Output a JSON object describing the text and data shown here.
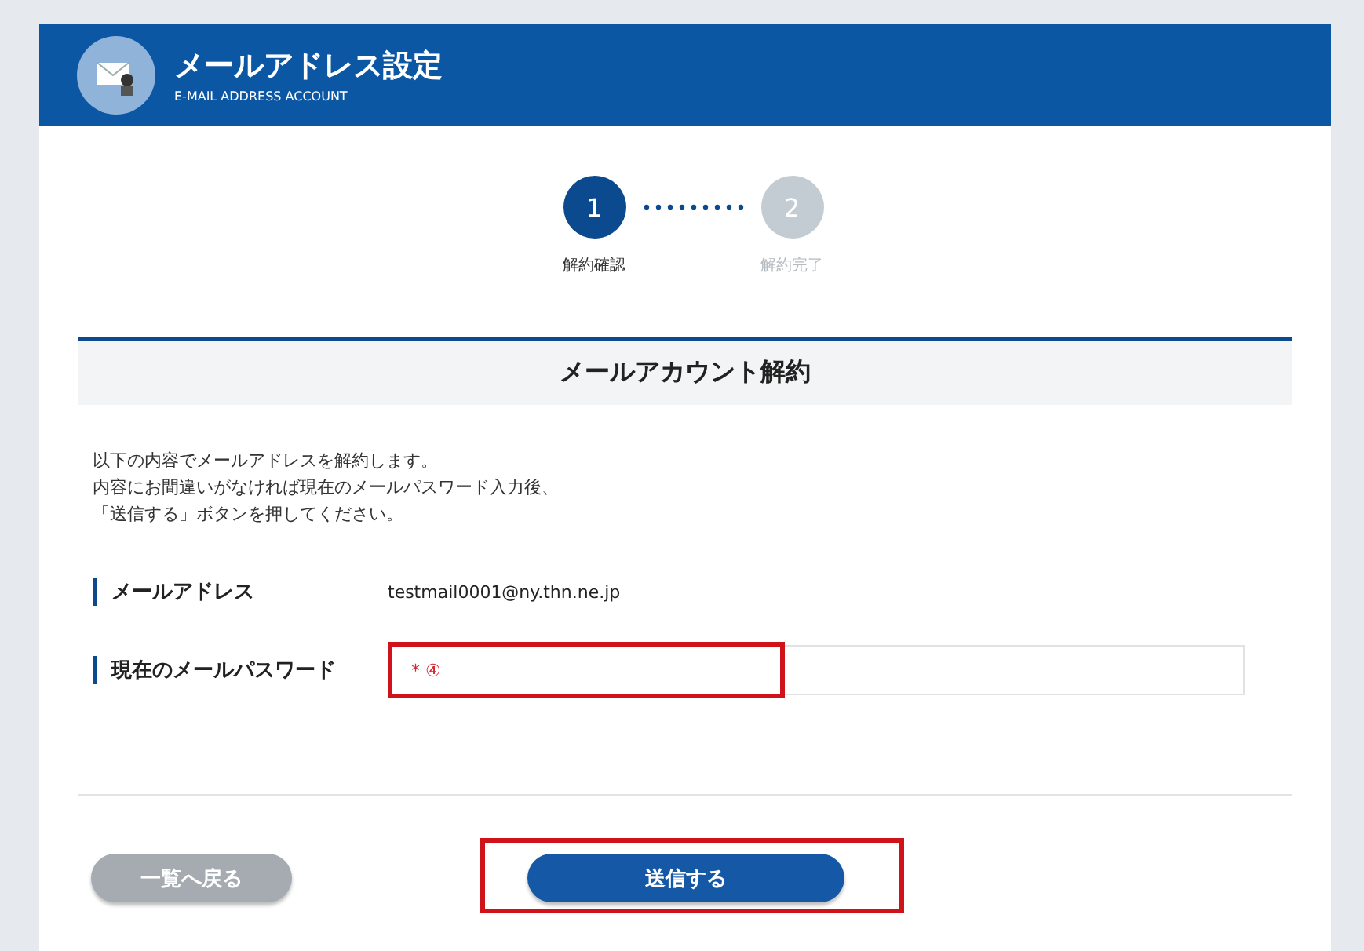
{
  "header": {
    "title": "メールアドレス設定",
    "subtitle": "E-MAIL ADDRESS ACCOUNT"
  },
  "steps": [
    {
      "number": "1",
      "label": "解約確認",
      "active": true
    },
    {
      "number": "2",
      "label": "解約完了",
      "active": false
    }
  ],
  "section": {
    "title": "メールアカウント解約"
  },
  "intro": [
    "以下の内容でメールアドレスを解約します。",
    "内容にお間違いがなければ現在のメールパスワード入力後、",
    "「送信する」ボタンを押してください。"
  ],
  "fields": [
    {
      "kind": "text",
      "label": "メールアドレス",
      "value": "testmail0001@ny.thn.ne.jp"
    },
    {
      "kind": "input",
      "label": "現在のメールパスワード",
      "marker": "* ④",
      "highlighted": true
    }
  ],
  "buttons": [
    {
      "label": "一覧へ戻る",
      "kind": "secondary",
      "highlighted": false
    },
    {
      "label": "送信する",
      "kind": "primary",
      "highlighted": true
    }
  ]
}
